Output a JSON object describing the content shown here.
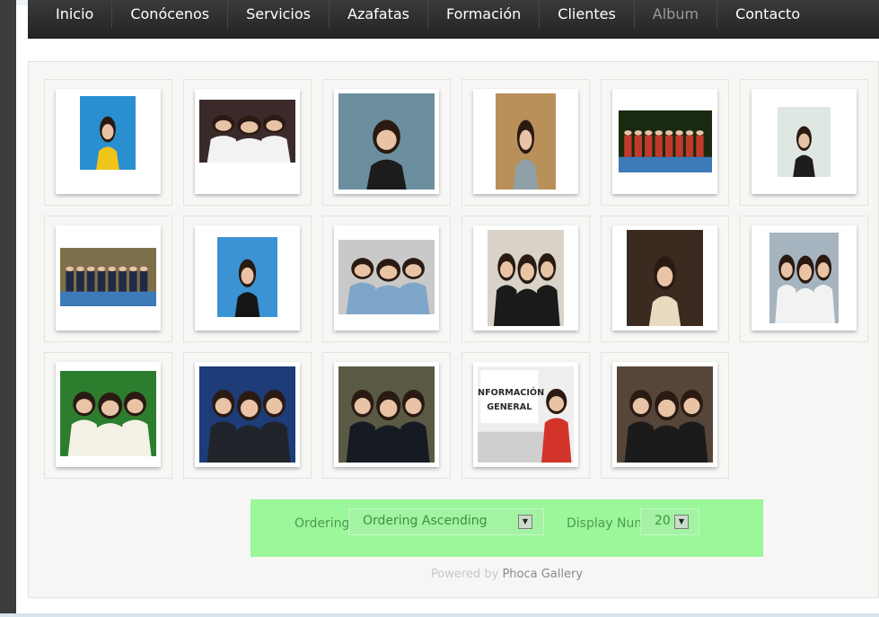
{
  "nav": {
    "items": [
      {
        "label": "Inicio"
      },
      {
        "label": "Conócenos"
      },
      {
        "label": "Servicios"
      },
      {
        "label": "Azafatas"
      },
      {
        "label": "Formación"
      },
      {
        "label": "Clientes"
      },
      {
        "label": "Album",
        "active": true
      },
      {
        "label": "Contacto"
      }
    ]
  },
  "gallery": {
    "photos": [
      {
        "kind": "portrait",
        "bg": "#2a8fd0",
        "accent": "#f0c419"
      },
      {
        "kind": "group",
        "bg": "#3a2a2a",
        "accent": "#f2f2f2"
      },
      {
        "kind": "portrait",
        "bg": "#6b8f9e",
        "accent": "#1c1c1c"
      },
      {
        "kind": "portrait",
        "bg": "#b9905a",
        "accent": "#8fa0a8"
      },
      {
        "kind": "crowd",
        "bg": "#1a2a10",
        "accent": "#c0392b"
      },
      {
        "kind": "portrait",
        "bg": "#dfe7e3",
        "accent": "#1d1d1d"
      },
      {
        "kind": "crowd",
        "bg": "#7d6f4a",
        "accent": "#1f2a44"
      },
      {
        "kind": "portrait",
        "bg": "#3c93d4",
        "accent": "#151515"
      },
      {
        "kind": "group",
        "bg": "#c9c9c9",
        "accent": "#7ea6c8"
      },
      {
        "kind": "group",
        "bg": "#d8d2c8",
        "accent": "#1a1a1a"
      },
      {
        "kind": "portrait",
        "bg": "#3a2a20",
        "accent": "#e8dcc0"
      },
      {
        "kind": "group",
        "bg": "#a6b4bf",
        "accent": "#f2f2f2"
      },
      {
        "kind": "group",
        "bg": "#2d7d2f",
        "accent": "#f4f1e6"
      },
      {
        "kind": "group",
        "bg": "#1d3c78",
        "accent": "#20242a"
      },
      {
        "kind": "group",
        "bg": "#5a5a44",
        "accent": "#161a22"
      },
      {
        "kind": "sign",
        "bg": "#eeeeee",
        "accent": "#d2342a",
        "sign_text": "INFORMACIÓN GENERAL"
      },
      {
        "kind": "group",
        "bg": "#56463a",
        "accent": "#1b1b1b"
      }
    ]
  },
  "controls": {
    "ordering_label": "Ordering",
    "ordering_value": "Ordering Ascending",
    "display_label": "Display Num",
    "display_value": "20"
  },
  "footer": {
    "powered_prefix": "Powered by",
    "powered_brand": "Phoca Gallery"
  },
  "colors": {
    "nav_bg": "#2e2e2e",
    "controls_bg": "#9af79a",
    "panel_bg": "#f6f6f4"
  }
}
